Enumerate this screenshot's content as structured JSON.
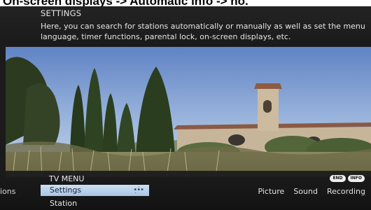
{
  "caption": "On-screen displays -> Automatic info -> no.",
  "info_panel": {
    "title": "SETTINGS",
    "description": "Here, you can search for stations automatically or manually as well as set the menu language, timer functions, parental lock, on-screen displays, etc."
  },
  "menu": {
    "title": "TV MENU",
    "left_partial": "ions",
    "selected_item": "Settings",
    "sub_item": "Station",
    "top_items": [
      "Picture",
      "Sound",
      "Recording"
    ],
    "keys": [
      "END",
      "INFO"
    ]
  },
  "colors": {
    "menu_highlight": "#bcd3ee",
    "panel_bg": "#1f1f1f"
  }
}
